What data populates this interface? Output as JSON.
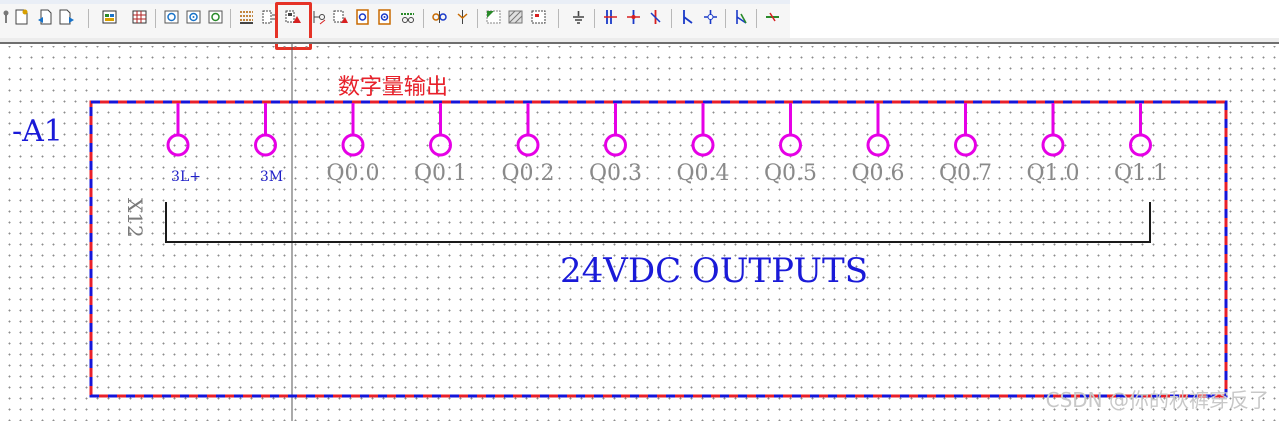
{
  "toolbar": {
    "buttons": [
      {
        "icon": "pin-icon"
      },
      {
        "icon": "new-page-icon"
      },
      {
        "icon": "undo-page-icon"
      },
      {
        "icon": "redo-page-icon"
      },
      {
        "icon": "window-macro-icon"
      },
      {
        "icon": "grid-symbol-icon"
      },
      {
        "icon": "gear-symbol-icon"
      },
      {
        "icon": "gear-symbol-2-icon"
      },
      {
        "icon": "gear-symbol-3-icon"
      },
      {
        "icon": "device-grid-icon"
      },
      {
        "icon": "device-list-icon"
      },
      {
        "icon": "plc-box-icon"
      },
      {
        "icon": "plc-connection-icon"
      },
      {
        "icon": "plc-card-icon"
      },
      {
        "icon": "plc-output-icon"
      },
      {
        "icon": "plc-input-icon"
      },
      {
        "icon": "terminal-strip-icon"
      },
      {
        "icon": "bus-port-icon"
      },
      {
        "icon": "connector-icon"
      },
      {
        "icon": "structure-box-icon"
      },
      {
        "icon": "hatch-box-icon"
      },
      {
        "icon": "black-box-icon"
      },
      {
        "icon": "ground-icon"
      },
      {
        "icon": "break-point-icon"
      },
      {
        "icon": "cross-point-icon"
      },
      {
        "icon": "interruption-icon"
      },
      {
        "icon": "corner-icon"
      },
      {
        "icon": "tee-icon"
      },
      {
        "icon": "potential-icon"
      },
      {
        "icon": "net-definition-icon"
      }
    ],
    "active_button": "plc-box-icon"
  },
  "schematic": {
    "title_annotation": "数字量输出",
    "device_tag": "-A1",
    "connector_tag": "X12",
    "pins": [
      "3L+",
      "3M",
      "Q0.0",
      "Q0.1",
      "Q0.2",
      "Q0.3",
      "Q0.4",
      "Q0.5",
      "Q0.6",
      "Q0.7",
      "Q1.0",
      "Q1.1"
    ],
    "group_label": "24VDC OUTPUTS"
  },
  "colors": {
    "pin": "#e600e6",
    "box_red": "#e8202a",
    "box_blue": "#1515d8",
    "annotation": "#e8202a",
    "small_pin_label": "#2020c8",
    "io_pin_label": "#8a8a8a",
    "group_label": "#1a1ad8",
    "bracket": "#1a1a1a",
    "device_tag": "#1a1ad8"
  },
  "watermark": "CSDN @你的秋裤穿反了"
}
